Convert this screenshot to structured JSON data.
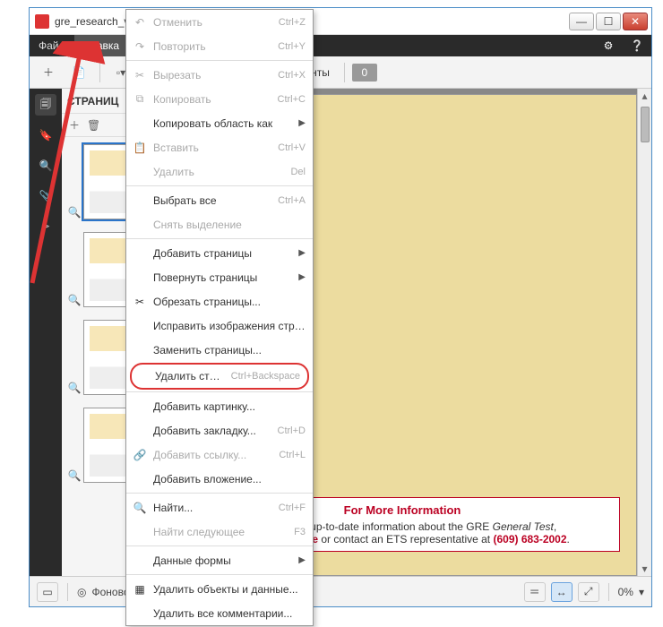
{
  "titlebar": {
    "title": "gre_research_va"
  },
  "menubar": {
    "file": "Файл",
    "edit": "Правка"
  },
  "toolbar": {
    "tools_label": "Инструменты",
    "comments_count": "0"
  },
  "pagespanel": {
    "title": "СТРАНИЦ"
  },
  "document": {
    "info_title": "For More Information",
    "info_line1_pre": "get the most up-to-date information about the GRE ",
    "info_line1_em": "General Test",
    "info_line1_post": ",",
    "info_line2_pre": "",
    "info_link": "www.ets.org/gre",
    "info_line2_mid": " or contact an ETS representative at ",
    "info_phone": "(609) 683-2002",
    "info_line2_post": "."
  },
  "statusbar": {
    "bg_mode": "Фоновое расп...",
    "zoom_value": "0%"
  },
  "dropdown": {
    "items": [
      {
        "icon": "↶",
        "label": "Отменить",
        "shortcut": "Ctrl+Z",
        "disabled": true
      },
      {
        "icon": "↷",
        "label": "Повторить",
        "shortcut": "Ctrl+Y",
        "disabled": true
      },
      {
        "sep": true
      },
      {
        "icon": "✂",
        "label": "Вырезать",
        "shortcut": "Ctrl+X",
        "disabled": true
      },
      {
        "icon": "⧉",
        "label": "Копировать",
        "shortcut": "Ctrl+C",
        "disabled": true
      },
      {
        "icon": "",
        "label": "Копировать область как",
        "submenu": true
      },
      {
        "icon": "📋",
        "label": "Вставить",
        "shortcut": "Ctrl+V",
        "disabled": true
      },
      {
        "icon": "",
        "label": "Удалить",
        "shortcut": "Del",
        "disabled": true
      },
      {
        "sep": true
      },
      {
        "icon": "",
        "label": "Выбрать все",
        "shortcut": "Ctrl+A"
      },
      {
        "icon": "",
        "label": "Снять выделение",
        "disabled": true
      },
      {
        "sep": true
      },
      {
        "icon": "",
        "label": "Добавить страницы",
        "submenu": true
      },
      {
        "icon": "",
        "label": "Повернуть страницы",
        "submenu": true
      },
      {
        "icon": "✂",
        "label": "Обрезать страницы..."
      },
      {
        "icon": "",
        "label": "Исправить изображения страниц..."
      },
      {
        "icon": "",
        "label": "Заменить страницы..."
      },
      {
        "icon": "",
        "label": "Удалить страницы...",
        "shortcut": "Ctrl+Backspace",
        "highlight": true
      },
      {
        "sep": true
      },
      {
        "icon": "",
        "label": "Добавить картинку..."
      },
      {
        "icon": "",
        "label": "Добавить закладку...",
        "shortcut": "Ctrl+D"
      },
      {
        "icon": "🔗",
        "label": "Добавить ссылку...",
        "shortcut": "Ctrl+L",
        "disabled": true
      },
      {
        "icon": "",
        "label": "Добавить вложение..."
      },
      {
        "sep": true
      },
      {
        "icon": "🔍",
        "label": "Найти...",
        "shortcut": "Ctrl+F"
      },
      {
        "icon": "",
        "label": "Найти следующее",
        "shortcut": "F3",
        "disabled": true
      },
      {
        "sep": true
      },
      {
        "icon": "",
        "label": "Данные формы",
        "submenu": true
      },
      {
        "sep": true
      },
      {
        "icon": "▦",
        "label": "Удалить объекты и данные..."
      },
      {
        "icon": "",
        "label": "Удалить все комментарии..."
      }
    ]
  }
}
